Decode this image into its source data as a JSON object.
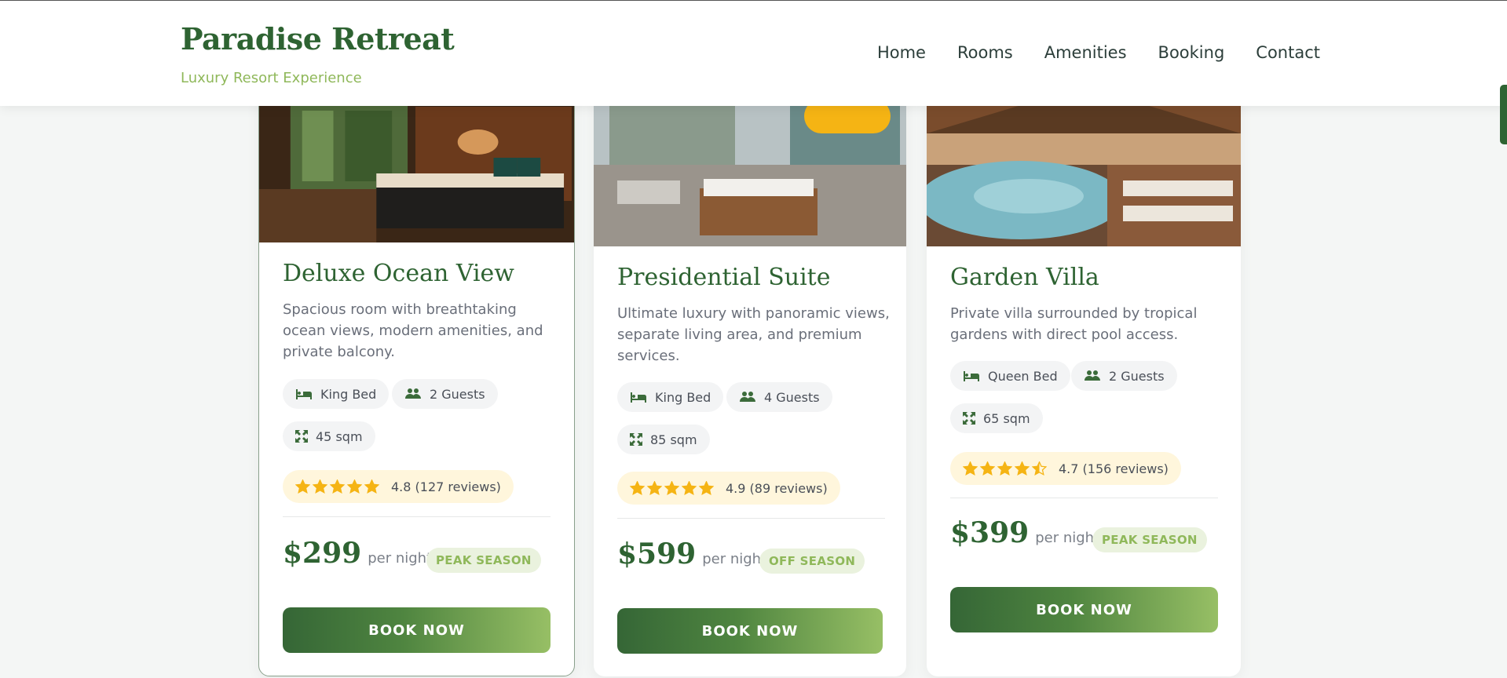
{
  "brand": {
    "title": "Paradise Retreat",
    "tagline": "Luxury Resort Experience"
  },
  "nav": [
    "Home",
    "Rooms",
    "Amenities",
    "Booking",
    "Contact"
  ],
  "colors": {
    "primary": "#2e6332",
    "accent": "#8fb85a",
    "star": "#f5b414"
  },
  "rooms": [
    {
      "title": "Deluxe Ocean View",
      "description": "Spacious room with breathtaking ocean views, modern amenities, and private balcony.",
      "bed": "King Bed",
      "guests": "2 Guests",
      "size": "45 sqm",
      "stars": 5,
      "rating_text": "4.8 (127 reviews)",
      "price": "$299",
      "per": "per night",
      "season": "PEAK SEASON",
      "cta": "BOOK NOW"
    },
    {
      "title": "Presidential Suite",
      "description": "Ultimate luxury with panoramic views, separate living area, and premium services.",
      "bed": "King Bed",
      "guests": "4 Guests",
      "size": "85 sqm",
      "stars": 5,
      "rating_text": "4.9 (89 reviews)",
      "price": "$599",
      "per": "per night",
      "season": "OFF SEASON",
      "cta": "BOOK NOW"
    },
    {
      "title": "Garden Villa",
      "description": "Private villa surrounded by tropical gardens with direct pool access.",
      "bed": "Queen Bed",
      "guests": "2 Guests",
      "size": "65 sqm",
      "stars": 4.5,
      "rating_text": "4.7 (156 reviews)",
      "price": "$399",
      "per": "per night",
      "season": "PEAK SEASON",
      "cta": "BOOK NOW"
    }
  ],
  "icons": {
    "bed": "bed-icon",
    "guests": "users-icon",
    "size": "expand-icon",
    "star": "star-icon"
  }
}
